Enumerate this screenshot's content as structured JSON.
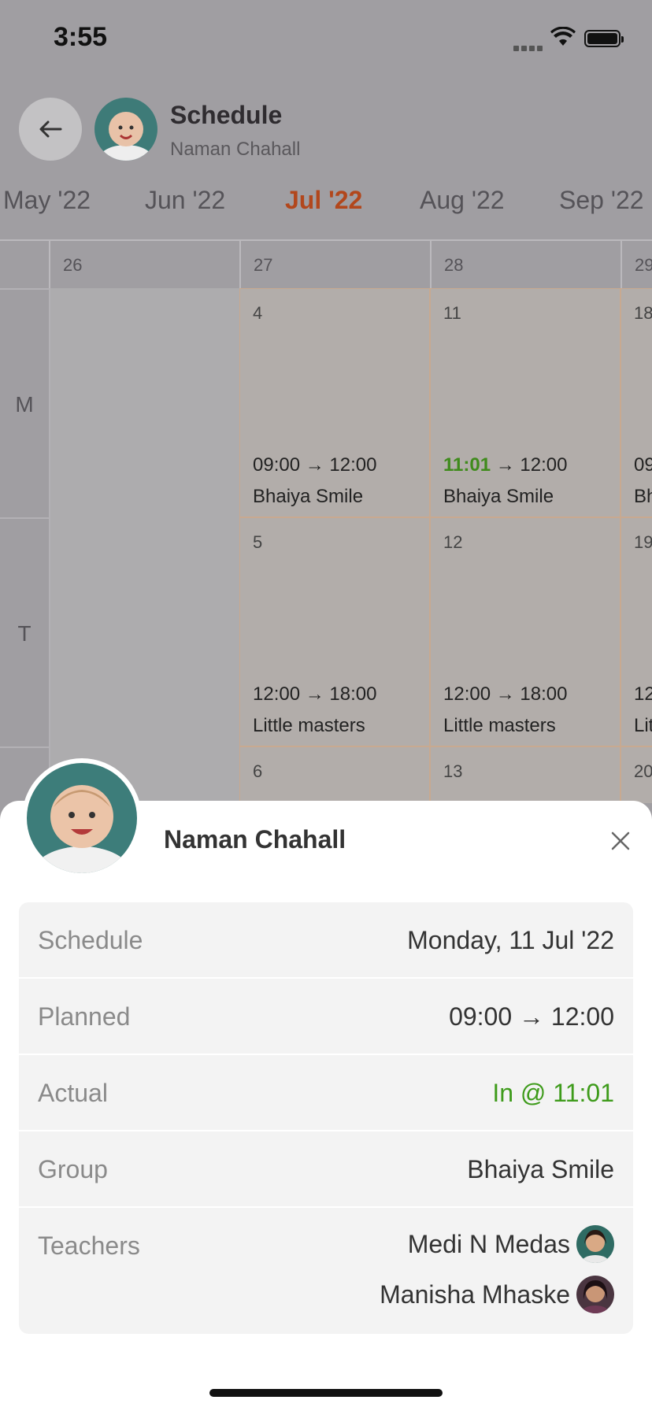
{
  "status_bar": {
    "time": "3:55"
  },
  "header": {
    "title": "Schedule",
    "subtitle": "Naman Chahall"
  },
  "months": [
    "May '22",
    "Jun '22",
    "Jul '22",
    "Aug '22",
    "Sep '22"
  ],
  "active_month": "Jul '22",
  "week_numbers": [
    "26",
    "27",
    "28",
    "29"
  ],
  "day_labels": [
    "M",
    "T"
  ],
  "week27": {
    "mon": {
      "date": "4",
      "time_start": "09:00",
      "arrow": "→",
      "time_end": "12:00",
      "group": "Bhaiya Smile"
    },
    "tue": {
      "date": "5",
      "time_start": "12:00",
      "arrow": "→",
      "time_end": "18:00",
      "group": "Little masters"
    },
    "wed": {
      "date": "6"
    }
  },
  "week28": {
    "mon": {
      "date": "11",
      "time_start": "11:01",
      "arrow": "→",
      "time_end": "12:00",
      "group": "Bhaiya Smile"
    },
    "tue": {
      "date": "12",
      "time_start": "12:00",
      "arrow": "→",
      "time_end": "18:00",
      "group": "Little masters"
    },
    "wed": {
      "date": "13"
    }
  },
  "week29": {
    "mon": {
      "date": "18",
      "time_start": "09",
      "group": "Bh"
    },
    "tue": {
      "date": "19",
      "time_start": "12",
      "group": "Lit"
    },
    "wed": {
      "date": "20"
    }
  },
  "sheet": {
    "name": "Naman Chahall",
    "rows": [
      {
        "label": "Schedule",
        "value": "Monday, 11 Jul '22"
      },
      {
        "label": "Planned",
        "value": "09:00 → 12:00"
      },
      {
        "label": "Actual",
        "value": "In @ 11:01"
      },
      {
        "label": "Group",
        "value": "Bhaiya Smile"
      }
    ],
    "teachers_label": "Teachers",
    "teachers": [
      "Medi N Medas",
      "Manisha Mhaske"
    ]
  },
  "colors": {
    "accent": "#b2471c",
    "success": "#3e9b1b"
  }
}
